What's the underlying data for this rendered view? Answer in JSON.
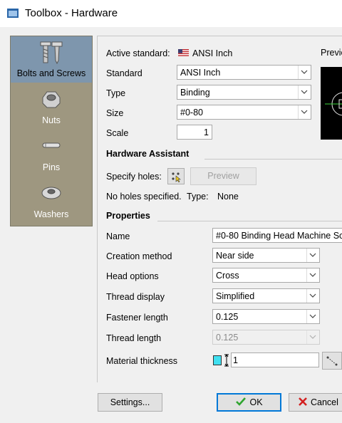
{
  "window": {
    "title": "Toolbox - Hardware"
  },
  "categories": [
    {
      "label": "Bolts and Screws",
      "icon": "bolts-screws-icon",
      "selected": true
    },
    {
      "label": "Nuts",
      "icon": "nut-icon"
    },
    {
      "label": "Pins",
      "icon": "pin-icon"
    },
    {
      "label": "Washers",
      "icon": "washer-icon"
    }
  ],
  "active_standard": {
    "label": "Active standard:",
    "value": "ANSI Inch",
    "flag_icon": "us-flag-icon"
  },
  "preview_label": "Previe",
  "fields": {
    "standard": {
      "label": "Standard",
      "value": "ANSI Inch"
    },
    "type": {
      "label": "Type",
      "value": "Binding"
    },
    "size": {
      "label": "Size",
      "value": "#0-80"
    },
    "scale": {
      "label": "Scale",
      "value": "1"
    }
  },
  "assistant": {
    "header": "Hardware Assistant",
    "specify_label": "Specify holes:",
    "preview_button": "Preview",
    "status_text": "No holes specified.",
    "type_label": "Type:",
    "type_value": "None"
  },
  "properties": {
    "header": "Properties",
    "name": {
      "label": "Name",
      "value": "#0-80 Binding Head Machine Sc"
    },
    "creation_method": {
      "label": "Creation method",
      "value": "Near side"
    },
    "head_options": {
      "label": "Head options",
      "value": "Cross"
    },
    "thread_display": {
      "label": "Thread display",
      "value": "Simplified"
    },
    "fastener_length": {
      "label": "Fastener length",
      "value": "0.125"
    },
    "thread_length": {
      "label": "Thread length",
      "value": "0.125"
    },
    "material_thickness": {
      "label": "Material thickness",
      "value": "1"
    }
  },
  "footer": {
    "settings": "Settings...",
    "ok": "OK",
    "cancel": "Cancel"
  },
  "colors": {
    "selected_category": "#7e96ad",
    "panel_bg": "#9e9780",
    "accent": "#0078d7",
    "swatch": "#40e0f0"
  }
}
